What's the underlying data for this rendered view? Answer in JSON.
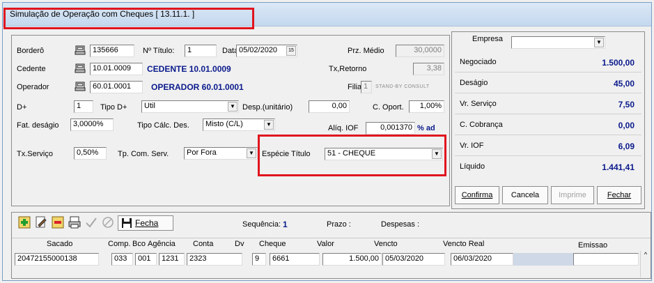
{
  "window": {
    "title": "Simulação de Operação com Cheques [ 13.11.1. ]"
  },
  "form": {
    "bordero_label": "Borderô",
    "bordero_value": "135666",
    "num_titulo_label": "Nº Título:",
    "num_titulo_value": "1",
    "data_label": "Data",
    "data_value": "05/02/2020",
    "prz_medio_label": "Prz. Médio",
    "prz_medio_value": "30,0000",
    "cedente_label": "Cedente",
    "cedente_code": "10.01.0009",
    "cedente_name": "CEDENTE 10.01.0009",
    "tx_retorno_label": "Tx,Retorno",
    "tx_retorno_value": "3,38",
    "operador_label": "Operador",
    "operador_code": "60.01.0001",
    "operador_name": "OPERADOR 60.01.0001",
    "filial_label": "Filial",
    "filial_value": "1",
    "filial_hint": "STAND-BY CONSULT",
    "dplus_label": "D+",
    "dplus_value": "1",
    "tipo_dplus_label": "Tipo D+",
    "tipo_dplus_value": "Util",
    "desp_label": "Desp.(unitário)",
    "desp_value": "0,00",
    "c_oport_label": "C. Oport.",
    "c_oport_value": "1,00%",
    "fat_desagio_label": "Fat. deságio",
    "fat_desagio_value": "3,0000%",
    "tipo_calc_label": "Tipo Cálc. Des.",
    "tipo_calc_value": "Misto (C/L)",
    "aliq_iof_label": "Alíq. IOF",
    "aliq_iof_value": "0,001370",
    "aliq_iof_unit": "% ad",
    "tx_servico_label": "Tx.Serviço",
    "tx_servico_value": "0,50%",
    "tp_com_serv_label": "Tp. Com. Serv.",
    "tp_com_serv_value": "Por Fora",
    "especie_label": "Espécie Título",
    "especie_value": "51 - CHEQUE"
  },
  "summary": {
    "empresa_label": "Empresa",
    "empresa_value": "",
    "rows": [
      {
        "label": "Negociado",
        "value": "1.500,00"
      },
      {
        "label": "Deságio",
        "value": "45,00"
      },
      {
        "label": "Vr. Serviço",
        "value": "7,50"
      },
      {
        "label": "C. Cobrança",
        "value": "0,00"
      },
      {
        "label": "Vr. IOF",
        "value": "6,09"
      },
      {
        "label": "Líquido",
        "value": "1.441,41"
      }
    ],
    "buttons": {
      "confirma": "Confirma",
      "cancela": "Cancela",
      "imprime": "Imprime",
      "fechar": "Fechar"
    }
  },
  "toolbar": {
    "fecha_label": "Fecha",
    "sequencia_label": "Sequência:",
    "sequencia_value": "1",
    "prazo_label": "Prazo :",
    "despesas_label": "Despesas :"
  },
  "grid": {
    "headers": {
      "sacado": "Sacado",
      "comp": "Comp.",
      "bco": "Bco",
      "agencia": "Agência",
      "conta": "Conta",
      "dv": "Dv",
      "cheque": "Cheque",
      "valor": "Valor",
      "vencto": "Vencto",
      "vencto_real": "Vencto Real",
      "emissao": "Emissao"
    },
    "row": {
      "sacado": "20472155000138",
      "comp": "033",
      "bco": "001",
      "agencia": "1231",
      "conta": "2323",
      "dv": "9",
      "cheque": "6661",
      "valor": "1.500,00",
      "vencto": "05/03/2020",
      "vencto_real": "06/03/2020",
      "emissao": ""
    }
  }
}
